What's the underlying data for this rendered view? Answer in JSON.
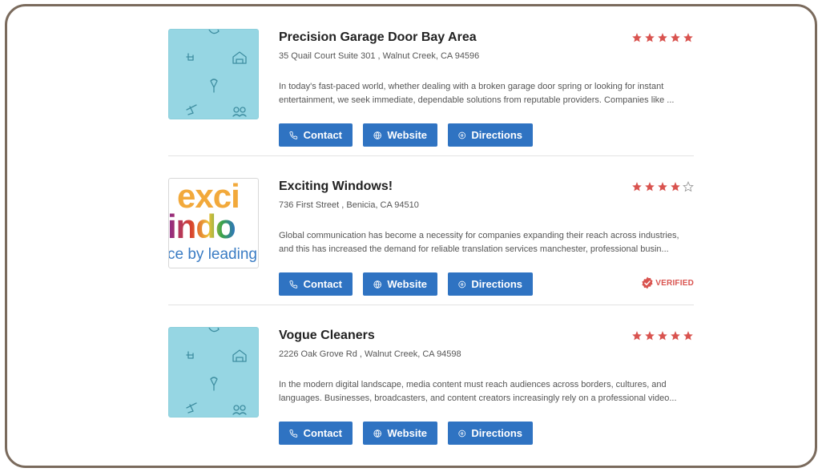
{
  "listings": [
    {
      "title": "Precision Garage Door Bay Area",
      "address": "35 Quail Court Suite 301 , Walnut Creek, CA 94596",
      "description_line1": "In today's fast-paced world, whether dealing with a broken garage door spring or looking for instant",
      "description_line2": "entertainment, we seek immediate, dependable solutions from reputable providers. Companies like ...",
      "rating": 5,
      "image": "pattern",
      "verified": false,
      "contact_label": "Contact",
      "website_label": "Website",
      "directions_label": "Directions"
    },
    {
      "title": "Exciting Windows!",
      "address": "736 First Street , Benicia, CA 94510",
      "description_line1": "Global communication has become a necessity for companies expanding their reach across industries,",
      "description_line2": "and this has increased the demand for reliable translation services manchester, professional busin...",
      "rating": 4,
      "image": "logo",
      "logo_line1": "exci",
      "logo_line2": "indo",
      "logo_line3": "ce by leading",
      "verified": true,
      "verified_label": "VERIFIED",
      "contact_label": "Contact",
      "website_label": "Website",
      "directions_label": "Directions"
    },
    {
      "title": "Vogue Cleaners",
      "address": "2226 Oak Grove Rd , Walnut Creek, CA 94598",
      "description_line1": "In the modern digital landscape, media content must reach audiences across borders, cultures, and",
      "description_line2": "languages. Businesses, broadcasters, and content creators increasingly rely on a professional video...",
      "rating": 5,
      "image": "pattern",
      "verified": false,
      "contact_label": "Contact",
      "website_label": "Website",
      "directions_label": "Directions"
    }
  ],
  "colors": {
    "button": "#2f73c2",
    "star": "#d9534f",
    "border": "#7a6a5c",
    "thumb": "#96d6e3"
  },
  "icons": {
    "contact": "phone-icon",
    "website": "globe-icon",
    "directions": "map-pin-icon",
    "verified": "verified-badge-icon",
    "rating": "star-icon"
  }
}
